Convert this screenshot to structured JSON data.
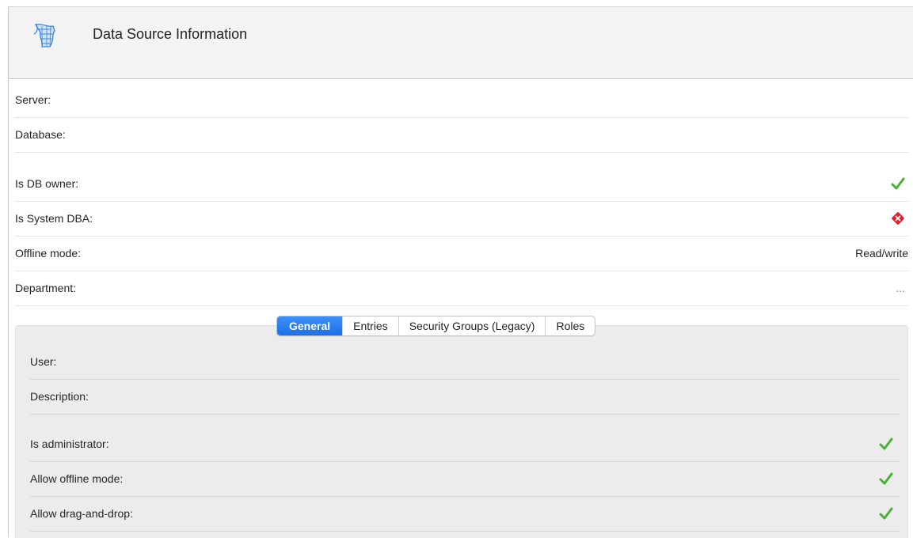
{
  "header": {
    "title": "Data Source Information",
    "logo_icon": "sql-server-logo-icon"
  },
  "info_rows": [
    {
      "label": "Server:",
      "value": ""
    },
    {
      "label": "Database:",
      "value": ""
    },
    {
      "label": "Is DB owner:",
      "status": "check"
    },
    {
      "label": "Is System DBA:",
      "status": "error"
    },
    {
      "label": "Offline mode:",
      "value": "Read/write"
    },
    {
      "label": "Department:",
      "value": "..."
    }
  ],
  "tabs": [
    {
      "label": "General",
      "active": true
    },
    {
      "label": "Entries",
      "active": false
    },
    {
      "label": "Security Groups (Legacy)",
      "active": false
    },
    {
      "label": "Roles",
      "active": false
    }
  ],
  "general": [
    {
      "label": "User:"
    },
    {
      "label": "Description:"
    },
    {
      "label": "Is administrator:",
      "status": "check"
    },
    {
      "label": "Allow offline mode:",
      "status": "check"
    },
    {
      "label": "Allow drag-and-drop:",
      "status": "check"
    }
  ],
  "colors": {
    "check": "#4caf3a",
    "error": "#e0202a",
    "tab_active": "#1f73e8"
  }
}
